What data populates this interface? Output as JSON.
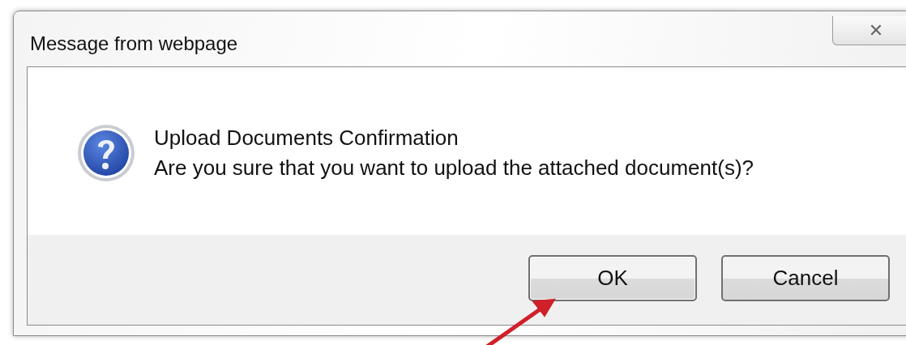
{
  "window": {
    "title": "Message from webpage",
    "close_label": "✕"
  },
  "message": {
    "heading": "Upload Documents Confirmation",
    "body": "Are you sure that you want to upload the attached document(s)?"
  },
  "buttons": [
    {
      "label": "OK",
      "kind": "default"
    },
    {
      "label": "Cancel",
      "kind": "cancel"
    }
  ]
}
